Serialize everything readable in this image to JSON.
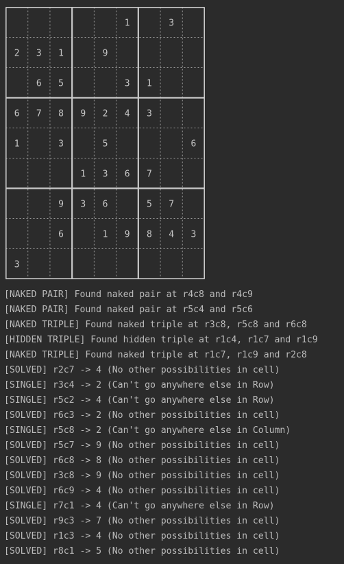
{
  "grid": [
    [
      "",
      "",
      "",
      "",
      "",
      "1",
      "",
      "3",
      ""
    ],
    [
      "2",
      "3",
      "1",
      "",
      "9",
      "",
      "",
      "",
      ""
    ],
    [
      "",
      "6",
      "5",
      "",
      "",
      "3",
      "1",
      "",
      ""
    ],
    [
      "6",
      "7",
      "8",
      "9",
      "2",
      "4",
      "3",
      "",
      ""
    ],
    [
      "1",
      "",
      "3",
      "",
      "5",
      "",
      "",
      "",
      "6"
    ],
    [
      "",
      "",
      "",
      "1",
      "3",
      "6",
      "7",
      "",
      ""
    ],
    [
      "",
      "",
      "9",
      "3",
      "6",
      "",
      "5",
      "7",
      ""
    ],
    [
      "",
      "",
      "6",
      "",
      "1",
      "9",
      "8",
      "4",
      "3"
    ],
    [
      "3",
      "",
      "",
      "",
      "",
      "",
      "",
      "",
      ""
    ]
  ],
  "log": [
    "[NAKED PAIR] Found naked pair at r4c8 and r4c9",
    "[NAKED PAIR] Found naked pair at r5c4 and r5c6",
    "[NAKED TRIPLE] Found naked triple at r3c8, r5c8 and r6c8",
    "[HIDDEN TRIPLE] Found hidden triple at r1c4, r1c7 and r1c9",
    "[NAKED TRIPLE] Found naked triple at r1c7, r1c9 and r2c8",
    "[SOLVED] r2c7 -> 4 (No other possibilities in cell)",
    "[SINGLE] r3c4 -> 2 (Can't go anywhere else in Row)",
    "[SINGLE] r5c2 -> 4 (Can't go anywhere else in Row)",
    "[SOLVED] r6c3 -> 2 (No other possibilities in cell)",
    "[SINGLE] r5c8 -> 2 (Can't go anywhere else in Column)",
    "[SOLVED] r5c7 -> 9 (No other possibilities in cell)",
    "[SOLVED] r6c8 -> 8 (No other possibilities in cell)",
    "[SOLVED] r3c8 -> 9 (No other possibilities in cell)",
    "[SOLVED] r6c9 -> 4 (No other possibilities in cell)",
    "[SINGLE] r7c1 -> 4 (Can't go anywhere else in Row)",
    "[SOLVED] r9c3 -> 7 (No other possibilities in cell)",
    "[SOLVED] r1c3 -> 4 (No other possibilities in cell)",
    "[SOLVED] r8c1 -> 5 (No other possibilities in cell)"
  ]
}
